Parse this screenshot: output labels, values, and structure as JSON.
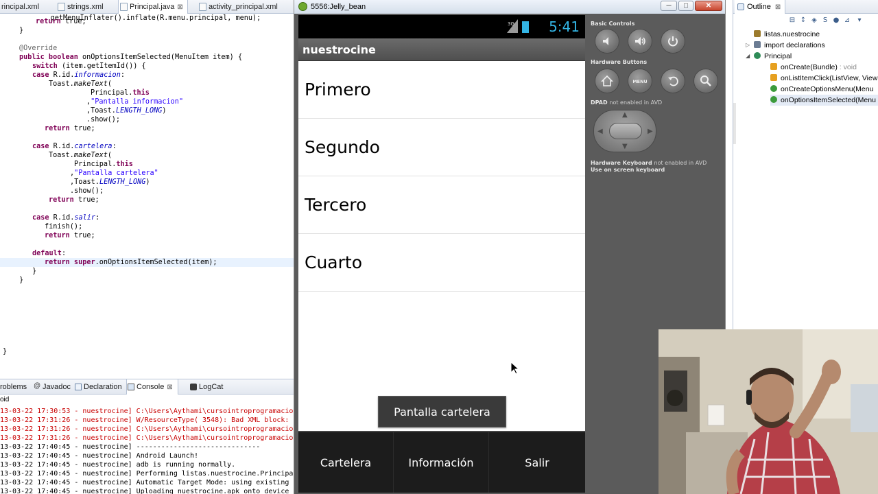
{
  "editor": {
    "tabs": [
      {
        "label": "rincipal.xml",
        "active": false
      },
      {
        "label": "strings.xml",
        "active": false
      },
      {
        "label": "Principal.java",
        "active": true,
        "close": "⊠"
      },
      {
        "label": "activity_principal.xml",
        "active": false
      }
    ],
    "code": {
      "l0": "            getMenuInflater().inflate(R.menu.principal, menu);",
      "l1_kw": "return",
      "l1_rest": " true;",
      "l2": "}",
      "l3": "@Override",
      "l4_kw": "public boolean",
      "l4_rest": " onOptionsItemSelected(MenuItem item) {",
      "l5_kw": "switch",
      "l5_rest": " (item.getItemId()) {",
      "l6_kw": "case",
      "l6_pre": " R.id.",
      "l6_it": "informacion",
      "l6_post": ":",
      "l7_pre": "Toast.",
      "l7_it": "makeText",
      "l7_post": "(",
      "l8_pre": "Principal.",
      "l8_kw": "this",
      "l9_pre": ",",
      "l9_str": "\"Pantalla informacion\"",
      "l10_pre": ",Toast.",
      "l10_it": "LENGTH_LONG",
      "l10_post": ")",
      "l11": ".show();",
      "l12_kw": "return",
      "l12_rest": " true;",
      "l13_kw": "case",
      "l13_pre": " R.id.",
      "l13_it": "cartelera",
      "l13_post": ":",
      "l14_pre": "Toast.",
      "l14_it": "makeText",
      "l14_post": "(",
      "l15_pre": "Principal.",
      "l15_kw": "this",
      "l16_pre": ",",
      "l16_str": "\"Pantalla cartelera\"",
      "l17_pre": ",Toast.",
      "l17_it": "LENGTH_LONG",
      "l17_post": ")",
      "l18": ".show();",
      "l19_kw": "return",
      "l19_rest": " true;",
      "l20_kw": "case",
      "l20_pre": " R.id.",
      "l20_it": "salir",
      "l20_post": ":",
      "l21": "finish();",
      "l22_kw": "return",
      "l22_rest": " true;",
      "l23_kw": "default",
      "l23_post": ":",
      "l24_kw": "return super",
      "l24_rest": ".onOptionsItemSelected(item);",
      "l25": "}",
      "l26": "}",
      "l27": "}"
    }
  },
  "console": {
    "tabs": [
      {
        "label": "roblems",
        "active": false
      },
      {
        "label": "Javadoc",
        "active": false
      },
      {
        "label": "Declaration",
        "active": false
      },
      {
        "label": "Console",
        "active": true,
        "close": "⊠"
      },
      {
        "label": "LogCat",
        "active": false
      }
    ],
    "subtitle": "oid",
    "lines": [
      {
        "text": "13-03-22 17:30:53 - nuestrocine] C:\\Users\\Aythami\\cursointroprogramacio",
        "color": "red"
      },
      {
        "text": "13-03-22 17:31:26 - nuestrocine] W/ResourceType( 3548): Bad XML block: ",
        "color": "red"
      },
      {
        "text": "13-03-22 17:31:26 - nuestrocine] C:\\Users\\Aythami\\cursointroprogramacio",
        "color": "red"
      },
      {
        "text": "13-03-22 17:31:26 - nuestrocine] C:\\Users\\Aythami\\cursointroprogramacio",
        "color": "red"
      },
      {
        "text": "13-03-22 17:40:45 - nuestrocine] ------------------------------",
        "color": "black"
      },
      {
        "text": "13-03-22 17:40:45 - nuestrocine] Android Launch!",
        "color": "black"
      },
      {
        "text": "13-03-22 17:40:45 - nuestrocine] adb is running normally.",
        "color": "black"
      },
      {
        "text": "13-03-22 17:40:45 - nuestrocine] Performing listas.nuestrocine.Principa",
        "color": "black"
      },
      {
        "text": "13-03-22 17:40:45 - nuestrocine] Automatic Target Mode: using existing",
        "color": "black"
      },
      {
        "text": "13-03-22 17:40:45 - nuestrocine] Uploading nuestrocine.apk onto device",
        "color": "black"
      }
    ]
  },
  "emulator": {
    "title": "5556:Jelly_bean",
    "window_buttons": {
      "minimize": "─",
      "maximize": "□",
      "close": "✕"
    },
    "status_time": "5:41",
    "app_title": "nuestrocine",
    "list_items": [
      "Primero",
      "Segundo",
      "Tercero",
      "Cuarto"
    ],
    "toast": "Pantalla cartelera",
    "menu_items": [
      "Cartelera",
      "Información",
      "Salir"
    ],
    "controls": {
      "basic_title": "Basic Controls",
      "hardware_title": "Hardware Buttons",
      "dpad_title": "DPAD",
      "dpad_note": "not enabled in AVD",
      "keyboard_title": "Hardware Keyboard",
      "keyboard_note": "not enabled in AVD",
      "keyboard_hint": "Use on screen keyboard"
    }
  },
  "outline": {
    "title": "Outline",
    "close": "⊠",
    "items": [
      {
        "label": "listas.nuestrocine",
        "detail": "",
        "indent": 0,
        "twisty": ""
      },
      {
        "label": "import declarations",
        "detail": "",
        "indent": 0,
        "twisty": "▷"
      },
      {
        "label": "Principal",
        "detail": "",
        "indent": 0,
        "twisty": "◢"
      },
      {
        "label": "onCreate(Bundle)",
        "detail": " : void",
        "indent": 1,
        "twisty": ""
      },
      {
        "label": "onListItemClick(ListView, View",
        "detail": "",
        "indent": 1,
        "twisty": ""
      },
      {
        "label": "onCreateOptionsMenu(Menu",
        "detail": "",
        "indent": 1,
        "twisty": ""
      },
      {
        "label": "onOptionsItemSelected(Menu",
        "detail": "",
        "indent": 1,
        "twisty": "",
        "selected": true
      }
    ]
  },
  "colors": {
    "accent": "#33b5e5",
    "error_text": "#c80000",
    "keyword": "#7f0055",
    "string": "#2a00ff",
    "field": "#0000c0"
  }
}
